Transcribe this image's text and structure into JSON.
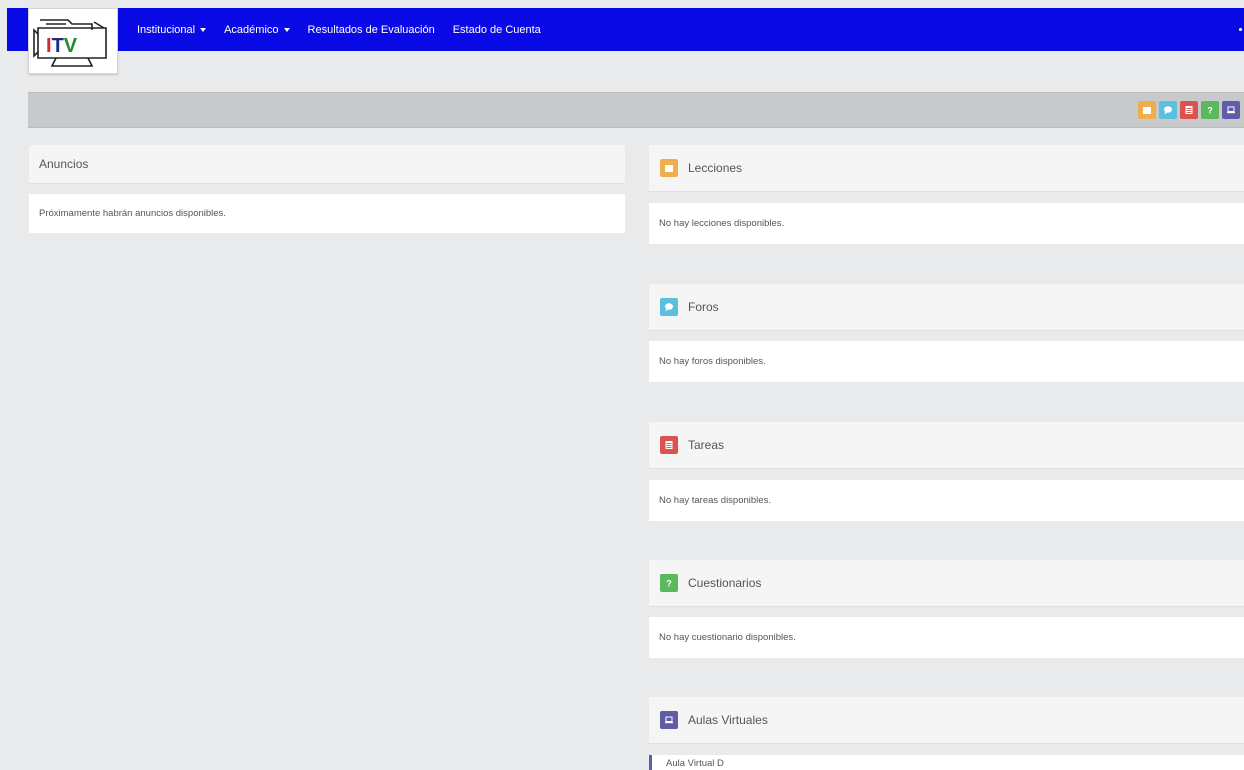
{
  "logo": {
    "text": "ITV"
  },
  "nav": {
    "items": [
      {
        "label": "Institucional",
        "dropdown": true
      },
      {
        "label": "Académico",
        "dropdown": true
      },
      {
        "label": "Resultados de Evaluación",
        "dropdown": false
      },
      {
        "label": "Estado de Cuenta",
        "dropdown": false
      }
    ]
  },
  "colors": {
    "navbar": "#0a0ae6",
    "lecciones": "#f0ad4e",
    "foros": "#5bc0de",
    "tareas": "#d9534f",
    "cuestionarios": "#5cb85c",
    "aulas": "#605ca8"
  },
  "toolbar": {
    "icons": [
      "lessons-icon",
      "forum-icon",
      "tasks-icon",
      "quiz-icon",
      "virtual-classroom-icon"
    ]
  },
  "anuncios": {
    "title": "Anuncios",
    "empty": "Próximamente habrán anuncios disponibles."
  },
  "lecciones": {
    "title": "Lecciones",
    "empty": "No hay lecciones disponibles."
  },
  "foros": {
    "title": "Foros",
    "empty": "No hay foros disponibles."
  },
  "tareas": {
    "title": "Tareas",
    "empty": "No hay tareas disponibles."
  },
  "cuestionarios": {
    "title": "Cuestionarios",
    "empty": "No hay cuestionario disponibles."
  },
  "aulas": {
    "title": "Aulas Virtuales",
    "items": [
      {
        "label": "Aula Virtual D"
      }
    ]
  }
}
